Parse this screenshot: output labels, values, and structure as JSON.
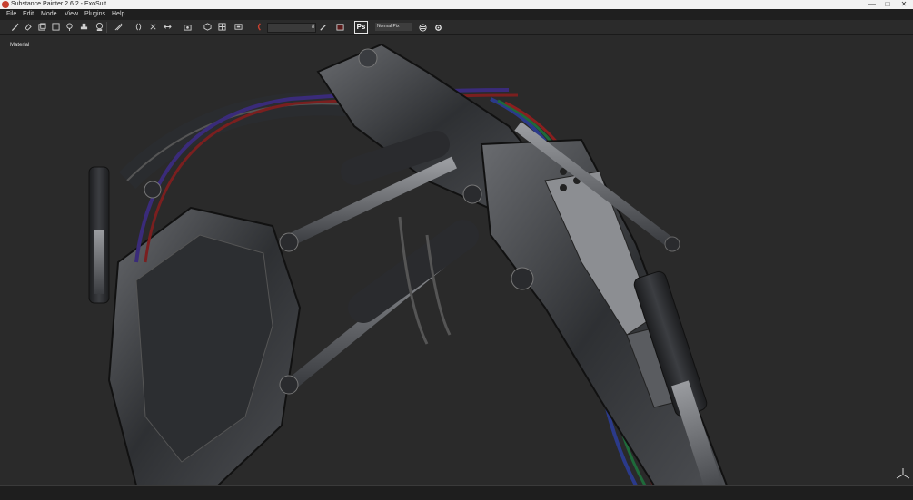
{
  "window": {
    "title": "Substance Painter 2.6.2 - ExoSuit",
    "controls": [
      "—",
      "□",
      "✕"
    ]
  },
  "menu": {
    "items": [
      "File",
      "Edit",
      "Mode",
      "View",
      "Plugins",
      "Help"
    ]
  },
  "toolbar": {
    "slider_value": "8",
    "photoshop_label": "Ps",
    "blend_mode": "Normal Pix"
  },
  "viewport": {
    "channel_label": "Material"
  },
  "colors": {
    "accent_red": "#c7402f",
    "viewport_bg": "#2a2a2a",
    "menubar_bg": "#1f1f1f"
  }
}
